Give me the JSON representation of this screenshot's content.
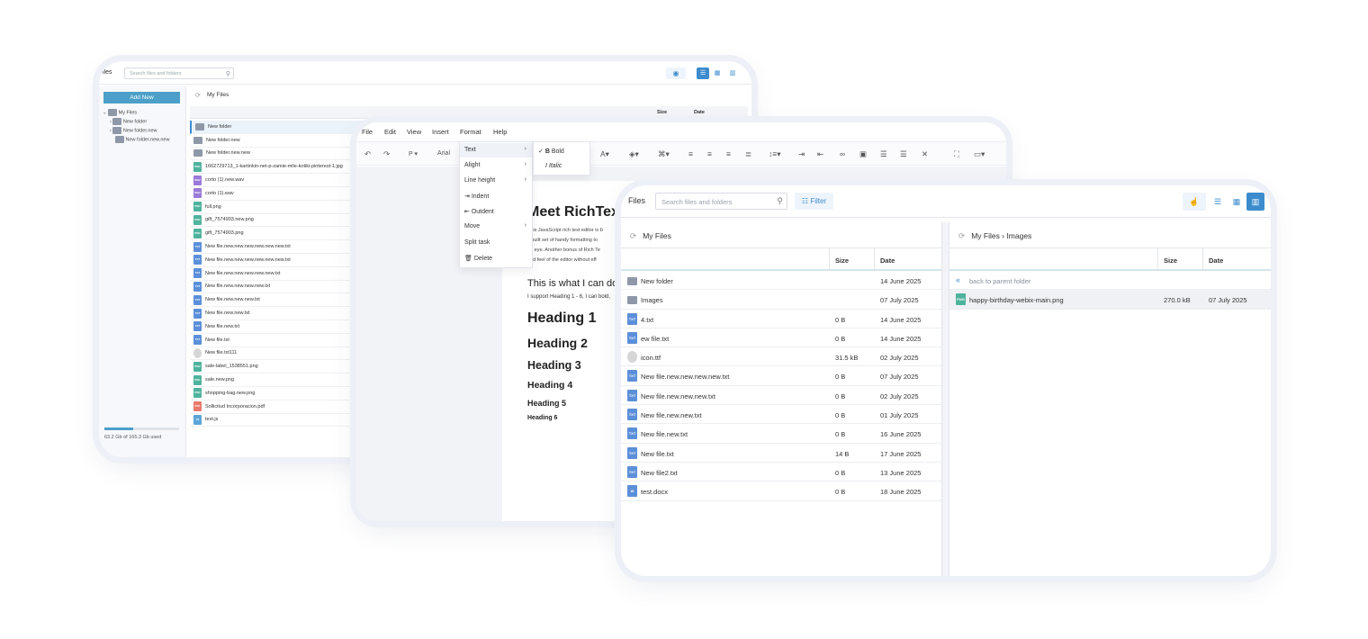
{
  "panel1": {
    "title": "iles",
    "search_placeholder": "Search files and folders",
    "add_new": "Add New",
    "tree": [
      "My Files",
      "New folder",
      "New folder.new",
      "New folder.new.new"
    ],
    "breadcrumb": "My Files",
    "columns": {
      "size": "Size",
      "date": "Date"
    },
    "files": [
      {
        "name": "New folder",
        "type": "folder"
      },
      {
        "name": "New folder.new",
        "type": "folder"
      },
      {
        "name": "New folder.new.new",
        "type": "folder"
      },
      {
        "name": "1662729713_1-kartinkin-net-p-zamie-mile-kotiki-pinterest-1.jpg",
        "type": "png"
      },
      {
        "name": "corto (1).new.wav",
        "type": "wav"
      },
      {
        "name": "corto (1).wav",
        "type": "wav"
      },
      {
        "name": "full.png",
        "type": "png"
      },
      {
        "name": "gift_7574903.new.png",
        "type": "png"
      },
      {
        "name": "gift_7574903.png",
        "type": "png"
      },
      {
        "name": "New file.new.new.new.new.new.new.txt",
        "type": "txt"
      },
      {
        "name": "New file.new.new.new.new.new.new.txt",
        "type": "txt"
      },
      {
        "name": "New file.new.new.new.new.new.txt",
        "type": "txt"
      },
      {
        "name": "New file.new.new.new.new.txt",
        "type": "txt"
      },
      {
        "name": "New file.new.new.new.txt",
        "type": "txt"
      },
      {
        "name": "New file.new.new.txt",
        "type": "txt"
      },
      {
        "name": "New file.new.txt",
        "type": "txt"
      },
      {
        "name": "New file.txt",
        "type": "txt"
      },
      {
        "name": "New file.txt111",
        "type": "ttf"
      },
      {
        "name": "sale-label_1538551.png",
        "type": "png"
      },
      {
        "name": "sale.new.png",
        "type": "png"
      },
      {
        "name": "shopping-bag.new.png",
        "type": "png"
      },
      {
        "name": "Sollicitud Incorporacion.pdf",
        "type": "pdf"
      },
      {
        "name": "test.js",
        "type": "js"
      }
    ],
    "usage": "63.2 Gb of 165.3 Gb used",
    "usage_fraction": 0.38
  },
  "panel2": {
    "menus": [
      "File",
      "Edit",
      "View",
      "Insert",
      "Format",
      "Help"
    ],
    "toolbar": {
      "paragraph": "P",
      "font": "Arial"
    },
    "dropdown": [
      "Text",
      "Alight",
      "Line height",
      "Indent",
      "Outdent",
      "Move",
      "Split task",
      "Delete"
    ],
    "submenu": [
      "Bold",
      "Italic"
    ],
    "doc": {
      "title": "Meet RichTex",
      "lines": [
        "This JavaScript rich text editor is b",
        "inbuilt set of handy formatting to",
        "an eye. Another bonus of Rich Te",
        "and feel of the editor without eff"
      ],
      "subtitle": "This is what I can do",
      "subtitle2": "I support Heading 1 - 6, I can bold,",
      "headings": [
        "Heading 1",
        "Heading 2",
        "Heading 3",
        "Heading 4",
        "Heading 5",
        "Heading 6"
      ]
    }
  },
  "panel3": {
    "title": "Files",
    "search_placeholder": "Search files and folders",
    "filter": "Filter",
    "left": {
      "breadcrumb": "My Files",
      "columns": {
        "size": "Size",
        "date": "Date"
      },
      "rows": [
        {
          "name": "New folder",
          "type": "folder",
          "size": "",
          "date": "14 June 2025"
        },
        {
          "name": "Images",
          "type": "folder",
          "size": "",
          "date": "07 July 2025"
        },
        {
          "name": "4.txt",
          "type": "txt",
          "size": "0 B",
          "date": "14 June 2025"
        },
        {
          "name": "ew file.txt",
          "type": "txt",
          "size": "0 B",
          "date": "14 June 2025"
        },
        {
          "name": "icon.ttf",
          "type": "ttf",
          "size": "31.5 kB",
          "date": "02 July 2025"
        },
        {
          "name": "New file.new.new.new.new.txt",
          "type": "txt",
          "size": "0 B",
          "date": "07 July 2025"
        },
        {
          "name": "New file.new.new.new.txt",
          "type": "txt",
          "size": "0 B",
          "date": "02 July 2025"
        },
        {
          "name": "New file.new.new.txt",
          "type": "txt",
          "size": "0 B",
          "date": "01 July 2025"
        },
        {
          "name": "New file.new.txt",
          "type": "txt",
          "size": "0 B",
          "date": "16 June 2025"
        },
        {
          "name": "New file.txt",
          "type": "txt",
          "size": "14 B",
          "date": "17 June 2025"
        },
        {
          "name": "New file2.txt",
          "type": "txt",
          "size": "0 B",
          "date": "13 June 2025"
        },
        {
          "name": "test.docx",
          "type": "docx",
          "size": "0 B",
          "date": "18 June 2025"
        }
      ]
    },
    "right": {
      "breadcrumb_root": "My Files",
      "breadcrumb_leaf": "Images",
      "columns": {
        "size": "Size",
        "date": "Date"
      },
      "back": "back to parent folder",
      "rows": [
        {
          "name": "happy-birthday-webix-main.png",
          "type": "png",
          "size": "270.0 kB",
          "date": "07 July 2025"
        }
      ]
    }
  },
  "badge_labels": {
    "txt": "TXT",
    "png": "PNG",
    "wav": "WAV",
    "pdf": "PDF",
    "js": "JS",
    "docx": "W",
    "ttf": "",
    "folder": ""
  }
}
